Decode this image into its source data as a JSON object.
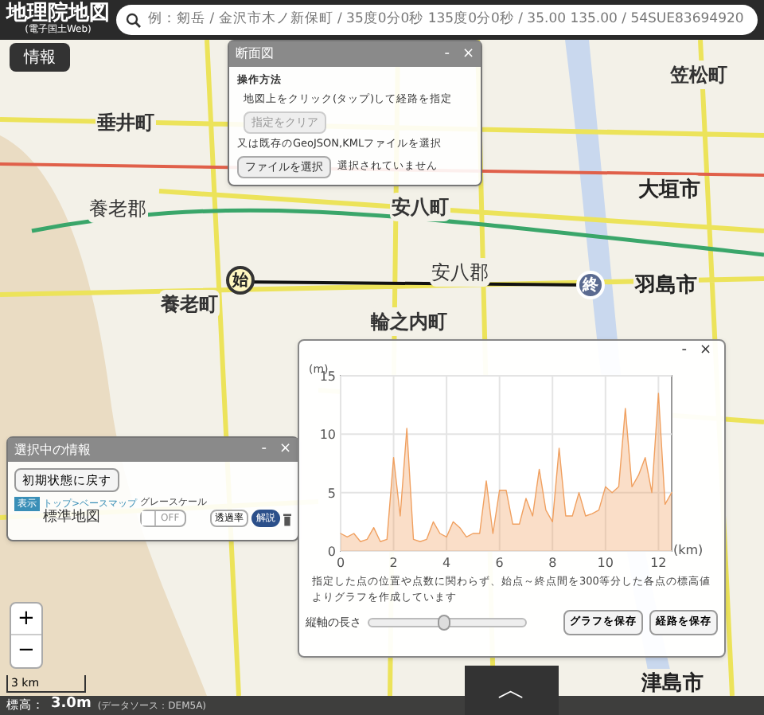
{
  "header": {
    "logo_title": "地理院地図",
    "logo_subtitle": "(電子国土Web)",
    "search": {
      "placeholder": "例：剱岳 / 金沢市木ノ新保町 / 35度0分0秒 135度0分0秒 / 35.00 135.00 / 54SUE83694920"
    }
  },
  "info_button": "情報",
  "map_labels": [
    {
      "text": "垂井町",
      "kind": "town"
    },
    {
      "text": "養老郡",
      "kind": "district"
    },
    {
      "text": "養老町",
      "kind": "town"
    },
    {
      "text": "安八町",
      "kind": "town"
    },
    {
      "text": "安八郡",
      "kind": "district"
    },
    {
      "text": "輪之内町",
      "kind": "town"
    },
    {
      "text": "大垣市",
      "kind": "city"
    },
    {
      "text": "羽島市",
      "kind": "city"
    },
    {
      "text": "笠松町",
      "kind": "town"
    },
    {
      "text": "津島市",
      "kind": "city"
    }
  ],
  "route_markers": [
    {
      "text": "始",
      "kind": "start"
    },
    {
      "text": "終",
      "kind": "end"
    }
  ],
  "profile_window": {
    "title": "断面図",
    "minimize": "-",
    "close": "×",
    "section_title": "操作方法",
    "instruction": "地図上をクリック(タップ)して経路を指定",
    "clear_button": {
      "label": "指定をクリア",
      "disabled": true
    },
    "file_instruction": "又は既存のGeoJSON,KMLファイルを選択",
    "file_button": "ファイルを選択",
    "file_status": "選択されていません"
  },
  "chart_window": {
    "minimize": "-",
    "close": "×",
    "chart_data": {
      "type": "area",
      "xlabel": "(km)",
      "ylabel": "(m)",
      "xlim": [
        0,
        12.5
      ],
      "ylim": [
        0,
        15
      ],
      "xticks": [
        0,
        2,
        4,
        6,
        8,
        10,
        12
      ],
      "yticks": [
        0,
        5,
        10,
        15
      ],
      "grid": true,
      "x": [
        0,
        0.25,
        0.5,
        0.75,
        1,
        1.25,
        1.5,
        1.75,
        2,
        2.25,
        2.5,
        2.75,
        3,
        3.25,
        3.5,
        3.75,
        4,
        4.25,
        4.5,
        4.75,
        5,
        5.25,
        5.5,
        5.75,
        6,
        6.25,
        6.5,
        6.75,
        7,
        7.25,
        7.5,
        7.75,
        8,
        8.25,
        8.5,
        8.75,
        9,
        9.25,
        9.5,
        9.75,
        10,
        10.25,
        10.5,
        10.75,
        11,
        11.25,
        11.5,
        11.75,
        12,
        12.25,
        12.5
      ],
      "series": [
        {
          "color": "#f0a060",
          "values": [
            1.5,
            1.2,
            1.5,
            0.8,
            1.0,
            2.0,
            0.8,
            1.0,
            8.0,
            3.0,
            10.5,
            1.0,
            0.8,
            1.0,
            2.5,
            1.5,
            1.2,
            2.5,
            2.0,
            1.2,
            1.5,
            1.5,
            6.0,
            1.5,
            5.2,
            5.2,
            2.3,
            2.3,
            4.5,
            3.0,
            7.0,
            3.5,
            2.5,
            8.8,
            3.0,
            3.0,
            5.0,
            3.0,
            3.2,
            3.5,
            5.5,
            5.0,
            5.5,
            12.2,
            5.5,
            6.5,
            8.0,
            5.0,
            13.5,
            4.0,
            5.0
          ]
        }
      ]
    },
    "note": "指定した点の位置や点数に関わらず、始点～終点間を300等分した各点の標高値よりグラフを作成しています",
    "slider": {
      "label": "縦軸の長さ",
      "level": 0.48
    },
    "buttons": [
      "グラフを保存",
      "経路を保存"
    ]
  },
  "layer_panel": {
    "title": "選択中の情報",
    "minimize": "-",
    "close": "×",
    "reset_button": "初期状態に戻す",
    "layer": {
      "tag": "表示",
      "category": "トップ>ベースマップ",
      "name": "標準地図",
      "grayscale_label": "グレースケール",
      "grayscale": {
        "on": false,
        "label": "OFF"
      },
      "opacity_button": "透過率",
      "detail_button": "解説"
    }
  },
  "zoom": {
    "in": "+",
    "out": "−"
  },
  "scale": "3 km",
  "status": {
    "label": "標高：",
    "value": "3.0m",
    "source": "(データソース：DEM5A)"
  },
  "bottom_toggle": "︿"
}
